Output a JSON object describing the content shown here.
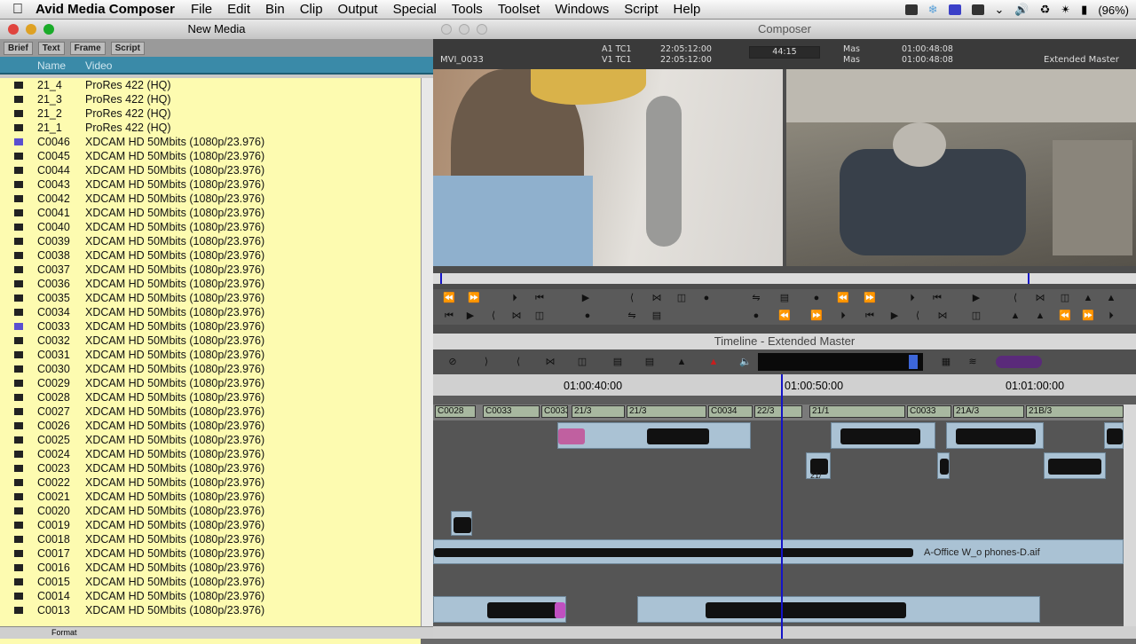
{
  "menubar": {
    "app_name": "Avid Media Composer",
    "items": [
      "File",
      "Edit",
      "Bin",
      "Clip",
      "Output",
      "Special",
      "Tools",
      "Toolset",
      "Windows",
      "Script",
      "Help"
    ],
    "battery": "(96%)"
  },
  "bin": {
    "title": "New Media",
    "tabs": [
      "Brief",
      "Text",
      "Frame",
      "Script"
    ],
    "columns": [
      "Name",
      "Video"
    ],
    "rows": [
      {
        "name": "21_4",
        "video": "ProRes 422 (HQ)",
        "icon": "dark"
      },
      {
        "name": "21_3",
        "video": "ProRes 422 (HQ)",
        "icon": "dark"
      },
      {
        "name": "21_2",
        "video": "ProRes 422 (HQ)",
        "icon": "dark"
      },
      {
        "name": "21_1",
        "video": "ProRes 422 (HQ)",
        "icon": "dark"
      },
      {
        "name": "C0046",
        "video": "XDCAM HD 50Mbits (1080p/23.976)",
        "icon": "blue"
      },
      {
        "name": "C0045",
        "video": "XDCAM HD 50Mbits (1080p/23.976)",
        "icon": "dark"
      },
      {
        "name": "C0044",
        "video": "XDCAM HD 50Mbits (1080p/23.976)",
        "icon": "dark"
      },
      {
        "name": "C0043",
        "video": "XDCAM HD 50Mbits (1080p/23.976)",
        "icon": "dark"
      },
      {
        "name": "C0042",
        "video": "XDCAM HD 50Mbits (1080p/23.976)",
        "icon": "dark"
      },
      {
        "name": "C0041",
        "video": "XDCAM HD 50Mbits (1080p/23.976)",
        "icon": "dark"
      },
      {
        "name": "C0040",
        "video": "XDCAM HD 50Mbits (1080p/23.976)",
        "icon": "dark"
      },
      {
        "name": "C0039",
        "video": "XDCAM HD 50Mbits (1080p/23.976)",
        "icon": "dark"
      },
      {
        "name": "C0038",
        "video": "XDCAM HD 50Mbits (1080p/23.976)",
        "icon": "dark"
      },
      {
        "name": "C0037",
        "video": "XDCAM HD 50Mbits (1080p/23.976)",
        "icon": "dark"
      },
      {
        "name": "C0036",
        "video": "XDCAM HD 50Mbits (1080p/23.976)",
        "icon": "dark"
      },
      {
        "name": "C0035",
        "video": "XDCAM HD 50Mbits (1080p/23.976)",
        "icon": "dark"
      },
      {
        "name": "C0034",
        "video": "XDCAM HD 50Mbits (1080p/23.976)",
        "icon": "dark"
      },
      {
        "name": "C0033",
        "video": "XDCAM HD 50Mbits (1080p/23.976)",
        "icon": "blue"
      },
      {
        "name": "C0032",
        "video": "XDCAM HD 50Mbits (1080p/23.976)",
        "icon": "dark"
      },
      {
        "name": "C0031",
        "video": "XDCAM HD 50Mbits (1080p/23.976)",
        "icon": "dark"
      },
      {
        "name": "C0030",
        "video": "XDCAM HD 50Mbits (1080p/23.976)",
        "icon": "dark"
      },
      {
        "name": "C0029",
        "video": "XDCAM HD 50Mbits (1080p/23.976)",
        "icon": "dark"
      },
      {
        "name": "C0028",
        "video": "XDCAM HD 50Mbits (1080p/23.976)",
        "icon": "dark"
      },
      {
        "name": "C0027",
        "video": "XDCAM HD 50Mbits (1080p/23.976)",
        "icon": "dark"
      },
      {
        "name": "C0026",
        "video": "XDCAM HD 50Mbits (1080p/23.976)",
        "icon": "dark"
      },
      {
        "name": "C0025",
        "video": "XDCAM HD 50Mbits (1080p/23.976)",
        "icon": "dark"
      },
      {
        "name": "C0024",
        "video": "XDCAM HD 50Mbits (1080p/23.976)",
        "icon": "dark"
      },
      {
        "name": "C0023",
        "video": "XDCAM HD 50Mbits (1080p/23.976)",
        "icon": "dark"
      },
      {
        "name": "C0022",
        "video": "XDCAM HD 50Mbits (1080p/23.976)",
        "icon": "dark"
      },
      {
        "name": "C0021",
        "video": "XDCAM HD 50Mbits (1080p/23.976)",
        "icon": "dark"
      },
      {
        "name": "C0020",
        "video": "XDCAM HD 50Mbits (1080p/23.976)",
        "icon": "dark"
      },
      {
        "name": "C0019",
        "video": "XDCAM HD 50Mbits (1080p/23.976)",
        "icon": "dark"
      },
      {
        "name": "C0018",
        "video": "XDCAM HD 50Mbits (1080p/23.976)",
        "icon": "dark"
      },
      {
        "name": "C0017",
        "video": "XDCAM HD 50Mbits (1080p/23.976)",
        "icon": "dark"
      },
      {
        "name": "C0016",
        "video": "XDCAM HD 50Mbits (1080p/23.976)",
        "icon": "dark"
      },
      {
        "name": "C0015",
        "video": "XDCAM HD 50Mbits (1080p/23.976)",
        "icon": "dark"
      },
      {
        "name": "C0014",
        "video": "XDCAM HD 50Mbits (1080p/23.976)",
        "icon": "dark"
      },
      {
        "name": "C0013",
        "video": "XDCAM HD 50Mbits (1080p/23.976)",
        "icon": "dark"
      }
    ],
    "footer_label": "Format"
  },
  "composer": {
    "title": "Composer",
    "source_clip": "MVI_0033",
    "a1_label": "A1 TC1",
    "v1_label": "V1 TC1",
    "src_tc1": "22:05:12:00",
    "src_tc2": "22:05:12:00",
    "duration": "44:15",
    "mas1": "Mas",
    "mas2": "Mas",
    "rec_tc1": "01:00:48:08",
    "rec_tc2": "01:00:48:08",
    "sequence": "Extended Master"
  },
  "timeline": {
    "title": "Timeline - Extended Master",
    "ruler": [
      "01:00:40:00",
      "01:00:50:00",
      "01:01:00:00"
    ],
    "clips_v": [
      "C0028",
      "C0033",
      "C0033",
      "21/3",
      "21/3",
      "C0034",
      "22/3",
      "21/1",
      "C0033",
      "21A/3",
      "21B/3"
    ],
    "audio_label": "A-Office W_o phones-D.aif",
    "clip_label_a": "21/"
  }
}
